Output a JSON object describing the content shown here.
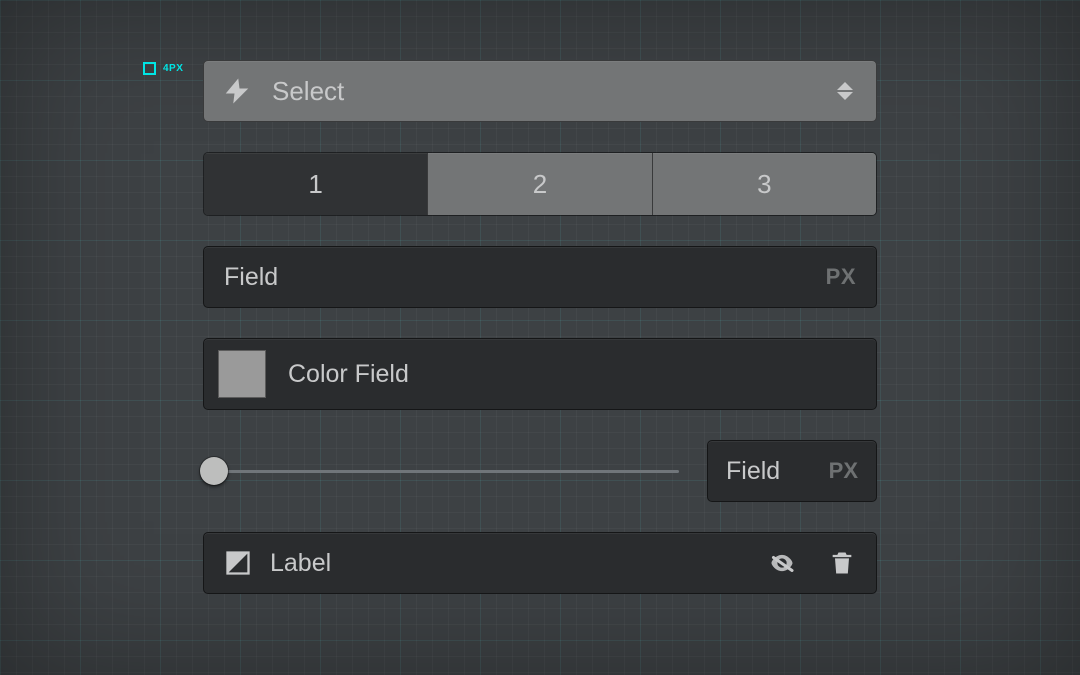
{
  "scale_badge": {
    "label": "4PX"
  },
  "select": {
    "label": "Select"
  },
  "segmented": {
    "options": [
      "1",
      "2",
      "3"
    ],
    "active_index": 0
  },
  "text_field": {
    "value": "Field",
    "unit": "PX"
  },
  "color_field": {
    "label": "Color Field",
    "swatch_hex": "#9a9a9a"
  },
  "slider": {
    "value_pct": 0,
    "field_value": "Field",
    "unit": "PX"
  },
  "layer_row": {
    "label": "Label"
  },
  "colors": {
    "accent": "#00e5e5",
    "panel_light": "#737576",
    "panel_dark": "#2a2c2e"
  }
}
